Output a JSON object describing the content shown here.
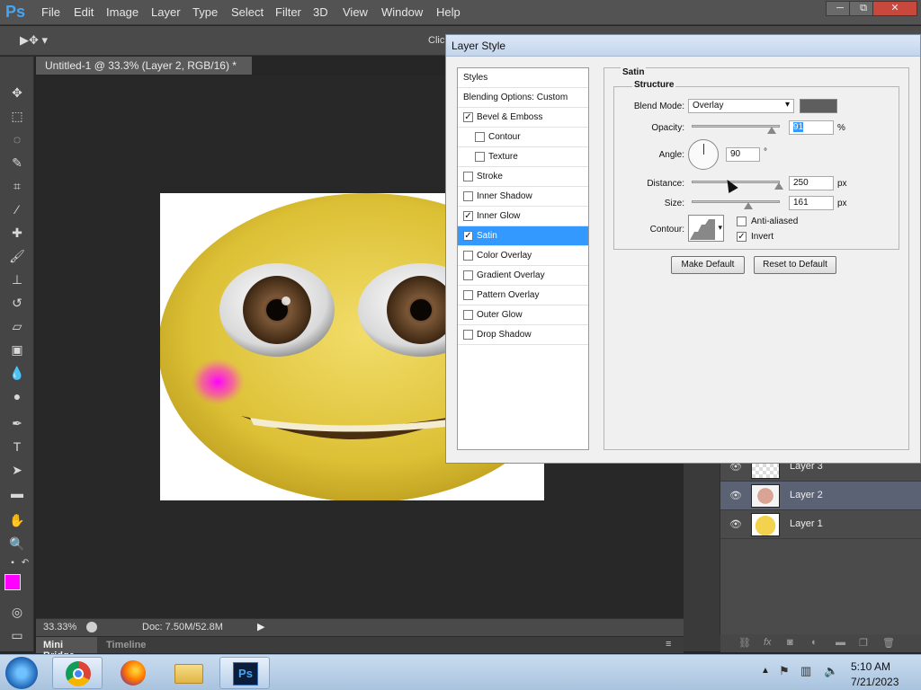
{
  "app": {
    "logo": "Ps"
  },
  "menu": [
    "File",
    "Edit",
    "Image",
    "Layer",
    "Type",
    "Select",
    "Filter",
    "3D",
    "View",
    "Window",
    "Help"
  ],
  "window_controls": {
    "minimize": "─",
    "restore": "⧉",
    "close": "✕"
  },
  "options_bar": {
    "tool_glyph": "▶✥ ▾",
    "hint": "Clic"
  },
  "document": {
    "tab_title": "Untitled-1 @ 33.3% (Layer 2, RGB/16) *"
  },
  "status": {
    "zoom": "33.33%",
    "doc_size": "Doc: 7.50M/52.8M"
  },
  "bottom_tabs": {
    "mini_bridge": "Mini Bridge",
    "timeline": "Timeline"
  },
  "colors": {
    "foreground": "#ff00ff",
    "background": "#ffffff",
    "accent": "#3399ff"
  },
  "layers": [
    {
      "name": "Layer 3",
      "visible": true,
      "selected": false
    },
    {
      "name": "Layer 2",
      "visible": true,
      "selected": true
    },
    {
      "name": "Layer 1",
      "visible": true,
      "selected": false
    }
  ],
  "layers_footer_icons": [
    "link-icon",
    "fx-icon",
    "mask-icon",
    "adjustment-icon",
    "folder-icon",
    "new-layer-icon",
    "trash-icon"
  ],
  "dialog": {
    "title": "Layer Style",
    "styles_header": "Styles",
    "blending_options": "Blending Options: Custom",
    "styles": [
      {
        "label": "Bevel & Emboss",
        "checked": true,
        "indent": false
      },
      {
        "label": "Contour",
        "checked": false,
        "indent": true
      },
      {
        "label": "Texture",
        "checked": false,
        "indent": true
      },
      {
        "label": "Stroke",
        "checked": false,
        "indent": false
      },
      {
        "label": "Inner Shadow",
        "checked": false,
        "indent": false
      },
      {
        "label": "Inner Glow",
        "checked": true,
        "indent": false
      },
      {
        "label": "Satin",
        "checked": true,
        "indent": false,
        "selected": true
      },
      {
        "label": "Color Overlay",
        "checked": false,
        "indent": false
      },
      {
        "label": "Gradient Overlay",
        "checked": false,
        "indent": false
      },
      {
        "label": "Pattern Overlay",
        "checked": false,
        "indent": false
      },
      {
        "label": "Outer Glow",
        "checked": false,
        "indent": false
      },
      {
        "label": "Drop Shadow",
        "checked": false,
        "indent": false
      }
    ],
    "satin": {
      "section_title": "Satin",
      "structure_title": "Structure",
      "blend_mode_label": "Blend Mode:",
      "blend_mode": "Overlay",
      "blend_color": "#5e5e5e",
      "opacity_label": "Opacity:",
      "opacity": "91",
      "opacity_unit": "%",
      "angle_label": "Angle:",
      "angle": "90",
      "angle_unit": "°",
      "distance_label": "Distance:",
      "distance": "250",
      "distance_unit": "px",
      "size_label": "Size:",
      "size": "161",
      "size_unit": "px",
      "contour_label": "Contour:",
      "anti_aliased_label": "Anti-aliased",
      "anti_aliased": false,
      "invert_label": "Invert",
      "invert": true,
      "make_default": "Make Default",
      "reset_default": "Reset to Default"
    }
  },
  "taskbar": {
    "time": "5:10 AM",
    "date": "7/21/2023",
    "app_ps": "Ps"
  }
}
